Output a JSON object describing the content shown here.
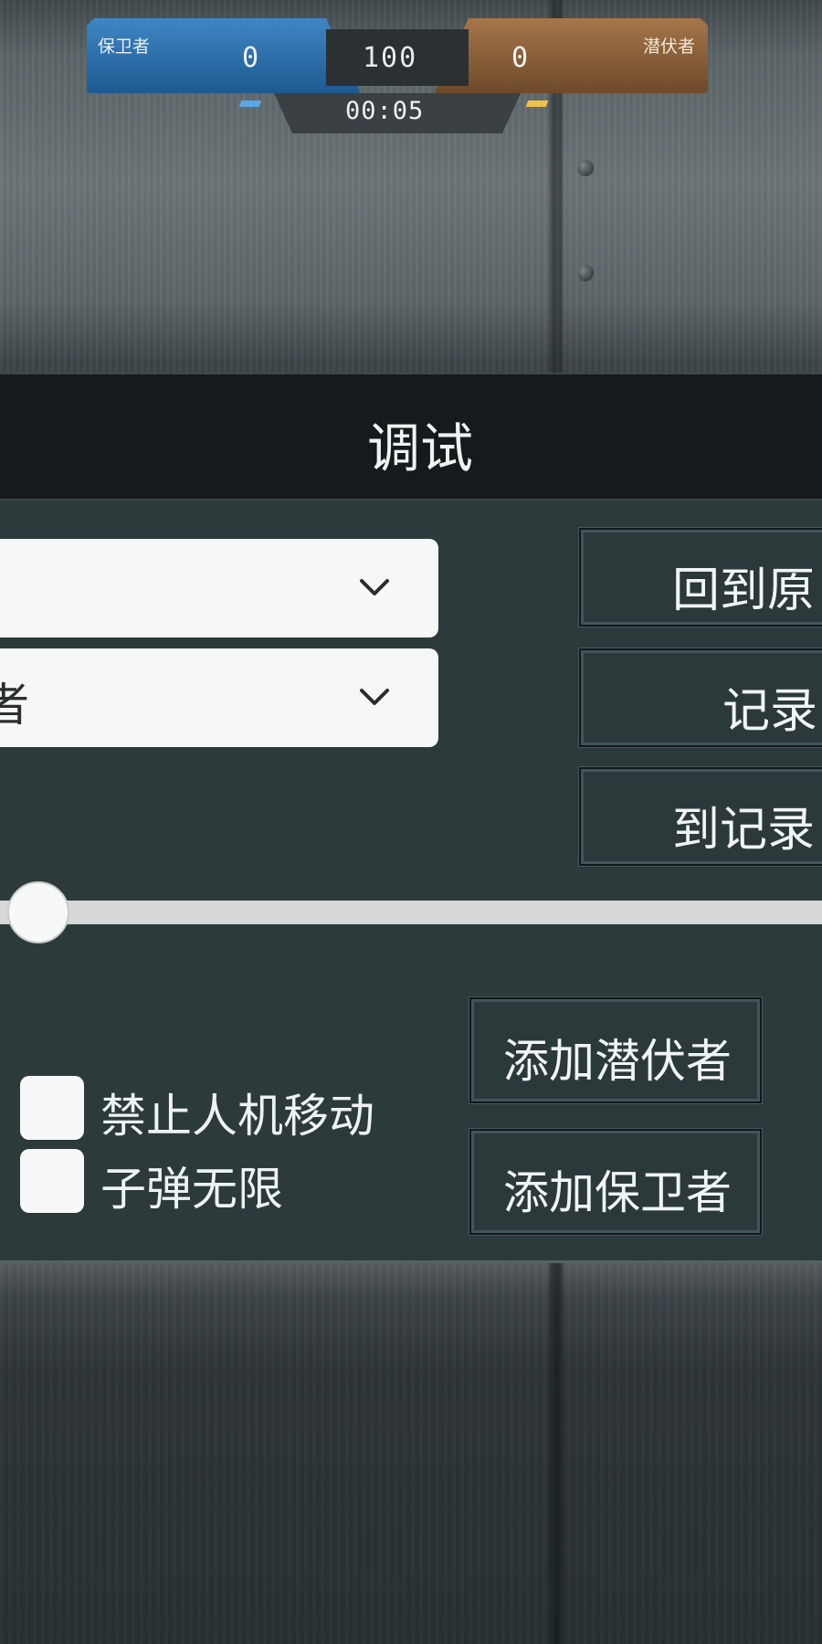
{
  "scoreboard": {
    "team_left": "保卫者",
    "team_left_score": "0",
    "target_score": "100",
    "team_right_score": "0",
    "team_right": "潜伏者",
    "timer": "00:05",
    "team_left_color": "#2f74b5",
    "team_right_color": "#8d6239"
  },
  "panel": {
    "title": "调试",
    "dropdowns": [
      {
        "value": ""
      },
      {
        "value": "者"
      }
    ],
    "right_buttons": [
      {
        "label": "回到原"
      },
      {
        "label": "记录"
      },
      {
        "label": "到记录"
      }
    ],
    "slider": {
      "value": 0
    },
    "add_buttons": [
      {
        "label": "添加潜伏者"
      },
      {
        "label": "添加保卫者"
      }
    ],
    "checkboxes": [
      {
        "label": "禁止人机移动",
        "checked": false
      },
      {
        "label": "子弹无限",
        "checked": false
      }
    ]
  }
}
